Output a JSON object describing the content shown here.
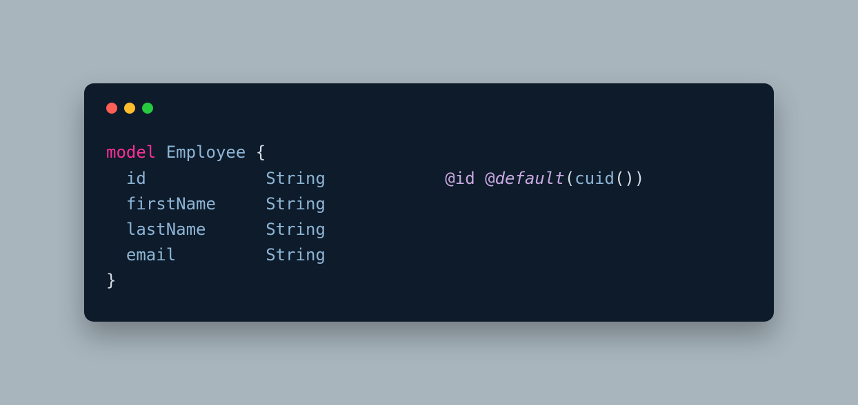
{
  "code": {
    "keyword": "model",
    "typeName": "Employee",
    "openBrace": "{",
    "closeBrace": "}",
    "fields": [
      {
        "name": "id",
        "type": "String",
        "attrId": "@id",
        "attrDefault": "@default",
        "attrFunc": "cuid",
        "hasAttrs": true
      },
      {
        "name": "firstName",
        "type": "String",
        "hasAttrs": false
      },
      {
        "name": "lastName",
        "type": "String",
        "hasAttrs": false
      },
      {
        "name": "email",
        "type": "String",
        "hasAttrs": false
      }
    ]
  }
}
